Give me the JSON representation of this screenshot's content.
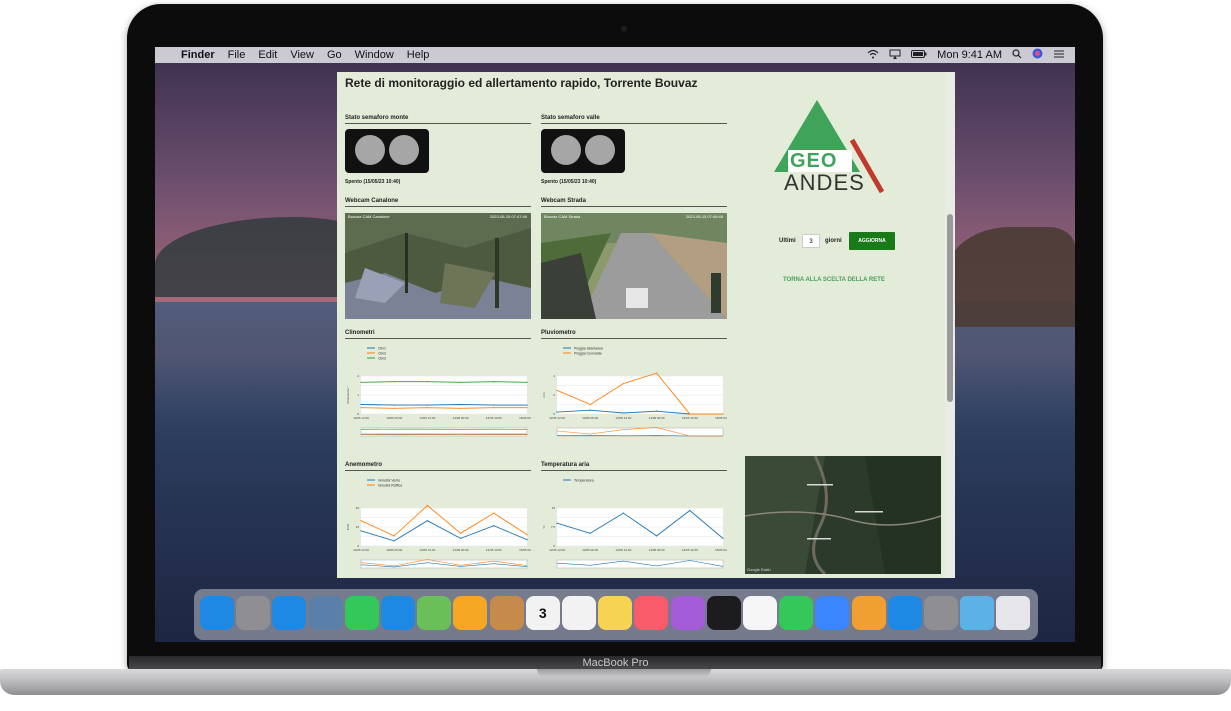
{
  "device": {
    "label": "MacBook Pro"
  },
  "menubar": {
    "app": "Finder",
    "items": [
      "File",
      "Edit",
      "View",
      "Go",
      "Window",
      "Help"
    ],
    "clock": "Mon 9:41 AM",
    "icons": [
      "apple-icon",
      "wifi-icon",
      "airplay-icon",
      "battery-icon",
      "spotlight-icon",
      "siri-icon",
      "control-center-icon"
    ]
  },
  "page": {
    "title": "Rete di monitoraggio ed allertamento rapido, Torrente Bouvaz",
    "semaforo_monte": {
      "title": "Stato semaforo monte",
      "status": "Spento (15/05/23 10:40)"
    },
    "semaforo_valle": {
      "title": "Stato semaforo valle",
      "status": "Spento (15/05/23 10:40)"
    },
    "webcam_canalone": {
      "title": "Webcam Canalone",
      "stamp_left": "Bouvaz CAM Canalone",
      "stamp_right": "2023-05-15 07:47:46"
    },
    "webcam_strada": {
      "title": "Webcam Strada",
      "stamp_left": "Bouvaz CAM Strada",
      "stamp_right": "2023-05-15 07:48:46"
    },
    "logo": {
      "word1": "GEO",
      "word2": "ANDES",
      "green": "#3fa45a",
      "red": "#c0392b"
    },
    "controls": {
      "prefix": "Ultimi",
      "days": "3",
      "suffix": "giorni",
      "update_button": "AGGIORNA"
    },
    "back_link": "TORNA ALLA SCELTA DELLA RETE",
    "map": {
      "credit": "Google Earth"
    }
  },
  "charts": {
    "clinometri": {
      "title": "Clinometri",
      "ylabel": "Inclinazione °",
      "legend": [
        "Clin1",
        "Clin2",
        "Clin3"
      ],
      "colors": [
        "#1f77b4",
        "#ff7f0e",
        "#2ca02c"
      ]
    },
    "pluviometro": {
      "title": "Pluviometro",
      "ylabel": "mm",
      "legend": [
        "Pioggia Istantanea",
        "Pioggia Cumulata"
      ],
      "colors": [
        "#1f77b4",
        "#ff7f0e"
      ]
    },
    "anemometro": {
      "title": "Anemometro",
      "ylabel": "km/h",
      "legend": [
        "Velocità Vento",
        "Velocità Raffica"
      ],
      "colors": [
        "#1f77b4",
        "#ff7f0e"
      ]
    },
    "temperatura": {
      "title": "Temperatura aria",
      "ylabel": "°C",
      "legend": [
        "Temperatura"
      ],
      "colors": [
        "#1f77b4"
      ]
    },
    "x_ticks": [
      "12/05 12:00",
      "13/05 00:00",
      "13/05 12:00",
      "14/05 00:00",
      "14/05 12:00",
      "15/05 00:00"
    ]
  },
  "chart_data": [
    {
      "type": "line",
      "title": "Clinometri",
      "ylabel": "Inclinazione °",
      "x": [
        "12/05 12:00",
        "13/05 00:00",
        "13/05 12:00",
        "14/05 00:00",
        "14/05 12:00",
        "15/05 00:00"
      ],
      "series": [
        {
          "name": "Clin1",
          "values": [
            -0.5,
            -0.6,
            -0.6,
            -0.5,
            -0.6,
            -0.6
          ]
        },
        {
          "name": "Clin2",
          "values": [
            -1.0,
            -1.1,
            -1.0,
            -1.1,
            -1.0,
            -1.0
          ]
        },
        {
          "name": "Clin3",
          "values": [
            3.0,
            3.1,
            3.1,
            3.0,
            3.1,
            3.0
          ]
        }
      ],
      "ylim": [
        -2,
        4
      ]
    },
    {
      "type": "line",
      "title": "Pluviometro",
      "ylabel": "mm",
      "x": [
        "12/05 12:00",
        "13/05 00:00",
        "13/05 12:00",
        "14/05 00:00",
        "14/05 12:00",
        "15/05 00:00"
      ],
      "series": [
        {
          "name": "Pioggia Istantanea",
          "values": [
            0.2,
            0.4,
            0.1,
            0.3,
            0.0,
            0.0
          ]
        },
        {
          "name": "Pioggia Cumulata",
          "values": [
            2.5,
            1.0,
            3.2,
            4.3,
            0.0,
            0.0
          ]
        }
      ],
      "ylim": [
        0,
        4
      ]
    },
    {
      "type": "line",
      "title": "Anemometro",
      "ylabel": "km/h",
      "x": [
        "12/05 12:00",
        "13/05 00:00",
        "13/05 12:00",
        "14/05 00:00",
        "14/05 12:00",
        "15/05 00:00"
      ],
      "series": [
        {
          "name": "Velocità Vento",
          "values": [
            12,
            4,
            20,
            6,
            16,
            5
          ]
        },
        {
          "name": "Velocità Raffica",
          "values": [
            20,
            8,
            32,
            10,
            26,
            9
          ]
        }
      ],
      "ylim": [
        0,
        30
      ]
    },
    {
      "type": "line",
      "title": "Temperatura aria",
      "ylabel": "°C",
      "x": [
        "12/05 12:00",
        "13/05 00:00",
        "13/05 12:00",
        "14/05 00:00",
        "14/05 12:00",
        "15/05 00:00"
      ],
      "series": [
        {
          "name": "Temperatura",
          "values": [
            9,
            5,
            13,
            4,
            14,
            3
          ]
        }
      ],
      "ylim": [
        0,
        15
      ]
    }
  ],
  "dock": {
    "apps": [
      "finder-icon",
      "launchpad-icon",
      "safari-icon",
      "preview-icon",
      "facetime-icon",
      "messages-icon",
      "maps-icon",
      "photos-icon",
      "contacts-icon",
      "calendar-icon",
      "reminders-icon",
      "notes-icon",
      "music-icon",
      "podcasts-icon",
      "tv-icon",
      "news-icon",
      "numbers-icon",
      "keynote-icon",
      "pages-icon",
      "app-store-icon",
      "system-preferences-icon",
      "folder-icon",
      "trash-icon"
    ],
    "colors": [
      "#1e88e5",
      "#8e8e93",
      "#1e88e5",
      "#5a7fa8",
      "#34c759",
      "#1e88e5",
      "#6bbf59",
      "#f5a623",
      "#c68a4c",
      "#f2f2f2",
      "#f2f2f2",
      "#f7d354",
      "#fa5b6b",
      "#a45cd8",
      "#1c1c1e",
      "#f5f5f5",
      "#34c759",
      "#3a86ff",
      "#f0a030",
      "#1e88e5",
      "#8e8e93",
      "#5ab2e6",
      "#e5e5ea"
    ],
    "calendar_day": "3"
  }
}
